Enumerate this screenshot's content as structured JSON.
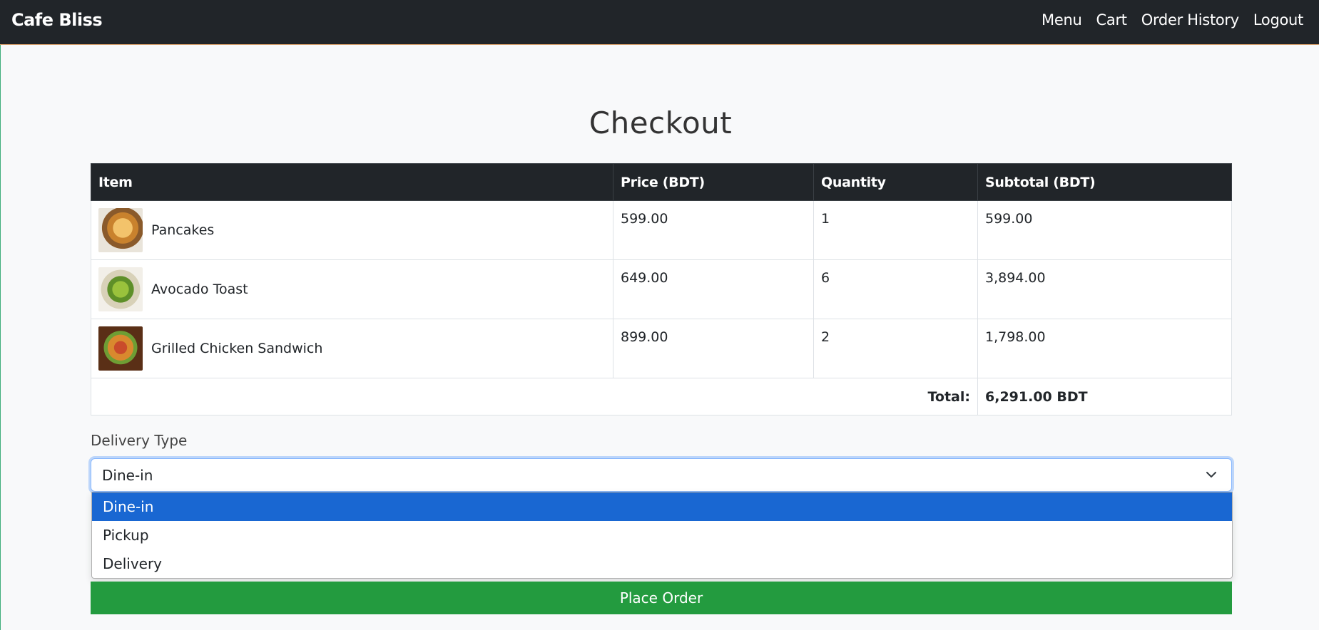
{
  "navbar": {
    "brand": "Cafe Bliss",
    "links": [
      "Menu",
      "Cart",
      "Order History",
      "Logout"
    ]
  },
  "page": {
    "title": "Checkout"
  },
  "table": {
    "headers": [
      "Item",
      "Price (BDT)",
      "Quantity",
      "Subtotal (BDT)"
    ],
    "rows": [
      {
        "name": "Pancakes",
        "price": "599.00",
        "quantity": "1",
        "subtotal": "599.00",
        "thumb": "pancakes"
      },
      {
        "name": "Avocado Toast",
        "price": "649.00",
        "quantity": "6",
        "subtotal": "3,894.00",
        "thumb": "avocado"
      },
      {
        "name": "Grilled Chicken Sandwich",
        "price": "899.00",
        "quantity": "2",
        "subtotal": "1,798.00",
        "thumb": "sandwich"
      }
    ],
    "total_label": "Total:",
    "total_value": "6,291.00 BDT"
  },
  "delivery": {
    "label": "Delivery Type",
    "selected": "Dine-in",
    "options": [
      "Dine-in",
      "Pickup",
      "Delivery"
    ]
  },
  "place_order_label": "Place Order",
  "colors": {
    "navbar": "#212529",
    "option_highlight": "#1967d2",
    "place_order": "#239b3f"
  }
}
